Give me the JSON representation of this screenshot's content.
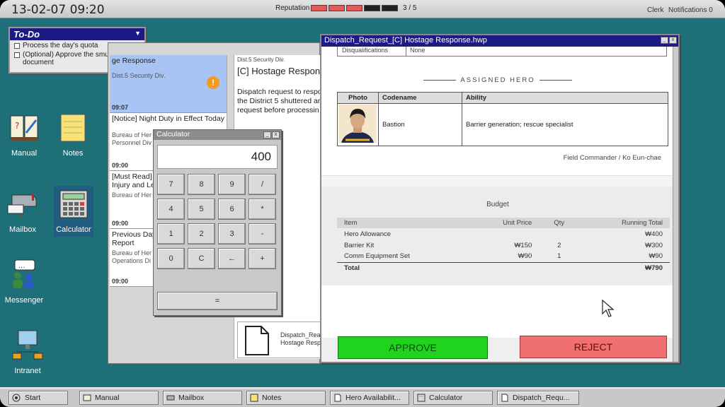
{
  "topbar": {
    "datetime": "13-02-07  09:20",
    "reputation_label": "Reputation",
    "reputation_value": 3,
    "reputation_max": 5,
    "reputation_text": "3 / 5",
    "user": "Clerk",
    "notifications": "Notifications 0"
  },
  "desktop_icons": [
    {
      "label": "Manual",
      "icon": "manual-icon"
    },
    {
      "label": "Notes",
      "icon": "notes-icon"
    },
    {
      "label": "Mailbox",
      "icon": "mailbox-icon"
    },
    {
      "label": "Calculator",
      "icon": "calculator-icon"
    },
    {
      "label": "Messenger",
      "icon": "messenger-icon"
    },
    {
      "label": "Intranet",
      "icon": "intranet-icon"
    }
  ],
  "todo": {
    "title": "To-Do",
    "items": [
      "Process the day's quota",
      "(Optional) Approve the smuggled document"
    ]
  },
  "mailbox": {
    "items": [
      {
        "subject": "ge Response",
        "from": "Dist.5 Security Div.",
        "time": "09:07"
      },
      {
        "subject": "[Notice] Night Duty in Effect Today",
        "from": "Bureau of Her",
        "from2": "Personnel Div",
        "time": "09:00"
      },
      {
        "subject": "[Must Read]",
        "subject2": "Injury and Le",
        "from": "Bureau of Her",
        "time": "09:00"
      },
      {
        "subject": "Previous Day",
        "subject2": "Report",
        "from": "Bureau of Her",
        "from2": "Operations Di",
        "time": "09:00"
      }
    ],
    "body": {
      "division": "Dist.5 Security Div.",
      "title": "[C] Hostage Respon",
      "lines": [
        "Dispatch request to respo",
        "the District 5 shuttered ar",
        "request before processin"
      ]
    },
    "attachment": {
      "name1": "Dispatch_Rea",
      "name2": "Hostage Resp"
    }
  },
  "calculator": {
    "title": "Calculator",
    "display": "400",
    "keys": [
      "7",
      "8",
      "9",
      "/",
      "4",
      "5",
      "6",
      "*",
      "1",
      "2",
      "3",
      "-",
      "0",
      "C",
      "←",
      "+"
    ],
    "equals": "="
  },
  "dispatch": {
    "title": "Dispatch_Request_[C] Hostage Response.hwp",
    "disqualifications_label": "Disqualifications",
    "disqualifications_value": "None",
    "assigned_hero_header": "ASSIGNED HERO",
    "hero_columns": [
      "Photo",
      "Codename",
      "Ability"
    ],
    "hero": {
      "codename": "Bastion",
      "ability": "Barrier generation; rescue specialist"
    },
    "commander": "Field Commander / Ko Eun-chae",
    "budget_title": "Budget",
    "budget_columns": [
      "Item",
      "Unit Price",
      "Qty",
      "Running Total"
    ],
    "budget_rows": [
      {
        "item": "Hero Allowance",
        "unit": "",
        "qty": "",
        "total": "₩400"
      },
      {
        "item": "Barrier Kit",
        "unit": "₩150",
        "qty": "2",
        "total": "₩300"
      },
      {
        "item": "Comm Equipment Set",
        "unit": "₩90",
        "qty": "1",
        "total": "₩90"
      }
    ],
    "total_label": "Total",
    "total_value": "₩790",
    "approve_label": "APPROVE",
    "reject_label": "REJECT"
  },
  "taskbar": {
    "start": "Start",
    "items": [
      "Manual",
      "Mailbox",
      "Notes",
      "Hero Availabilit...",
      "Calculator",
      "Dispatch_Requ..."
    ]
  },
  "colors": {
    "desktop": "#1e6f77",
    "title_bar": "#1c1a84",
    "approve": "#1fd31f",
    "reject": "#f07070",
    "reputation_fill": "#e05a5a"
  }
}
